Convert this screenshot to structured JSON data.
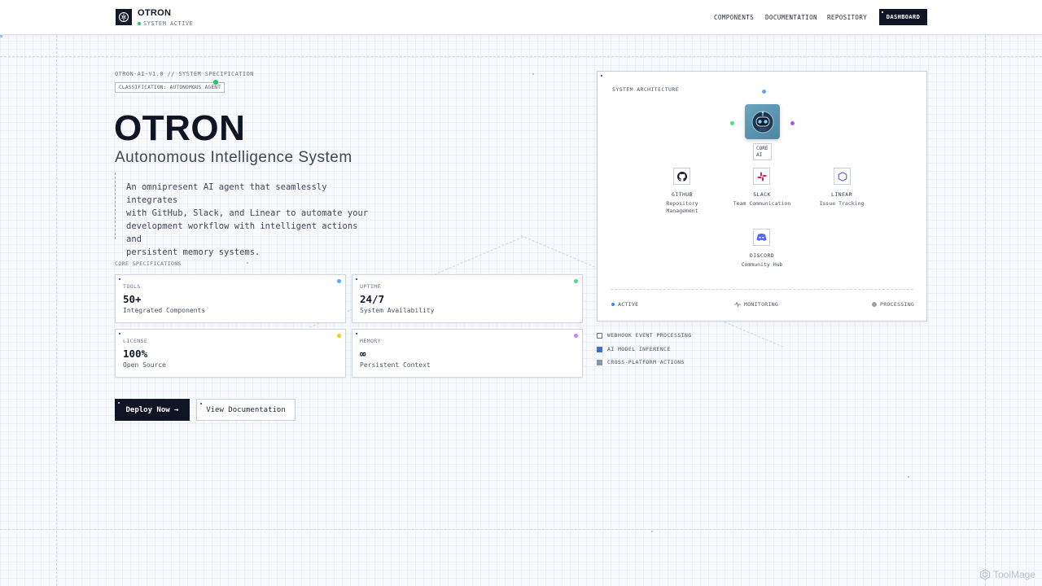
{
  "header": {
    "brand": "OTRON",
    "status": "SYSTEM ACTIVE",
    "nav": [
      "COMPONENTS",
      "DOCUMENTATION",
      "REPOSITORY"
    ],
    "cta": "DASHBOARD"
  },
  "hero": {
    "spec_id": "OTRON-AI-V1.0 // SYSTEM SPECIFICATION",
    "classification": "CLASSIFICATION: AUTONOMOUS AGENT",
    "title": "OTRON",
    "subtitle": "Autonomous Intelligence System",
    "description_lines": [
      "An omnipresent AI agent that seamlessly integrates",
      "with GitHub, Slack, and Linear to automate your",
      "development workflow with intelligent actions and",
      "persistent memory systems."
    ]
  },
  "specs": {
    "section_label": "CORE SPECIFICATIONS",
    "cards": [
      {
        "label": "TOOLS",
        "value": "50+",
        "sub": "Integrated Components",
        "dot_color": "#60a5fa"
      },
      {
        "label": "UPTIME",
        "value": "24/7",
        "sub": "System Availability",
        "dot_color": "#4ade80"
      },
      {
        "label": "LICENSE",
        "value": "100%",
        "sub": "Open Source",
        "dot_color": "#facc15"
      },
      {
        "label": "MEMORY",
        "value": "∞",
        "sub": "Persistent Context",
        "dot_color": "#c084fc"
      }
    ]
  },
  "actions": {
    "primary": "Deploy Now →",
    "secondary": "View Documentation"
  },
  "architecture": {
    "title": "SYSTEM ARCHITECTURE",
    "core_label_lines": [
      "CORE",
      "AI"
    ],
    "integrations": [
      {
        "name": "GITHUB",
        "desc_lines": [
          "Repository",
          "Management"
        ],
        "icon": "github-icon"
      },
      {
        "name": "SLACK",
        "desc_lines": [
          "Team Communication"
        ],
        "icon": "slack-icon"
      },
      {
        "name": "LINEAR",
        "desc_lines": [
          "Issue Tracking"
        ],
        "icon": "linear-icon"
      },
      {
        "name": "DISCORD",
        "desc_lines": [
          "Community Hub"
        ],
        "icon": "discord-icon"
      }
    ],
    "legend": [
      {
        "label": "ACTIVE",
        "color": "#3b82f6"
      },
      {
        "label": "MONITORING",
        "color": "#6b7280"
      },
      {
        "label": "PROCESSING",
        "color": "#9ca3af"
      }
    ]
  },
  "processes": [
    {
      "label": "WEBHOOK EVENT PROCESSING",
      "style": "outline"
    },
    {
      "label": "AI MODEL INFERENCE",
      "style": "blue"
    },
    {
      "label": "CROSS-PLATFORM ACTIONS",
      "style": "gray"
    }
  ],
  "watermark": "ToolMage"
}
